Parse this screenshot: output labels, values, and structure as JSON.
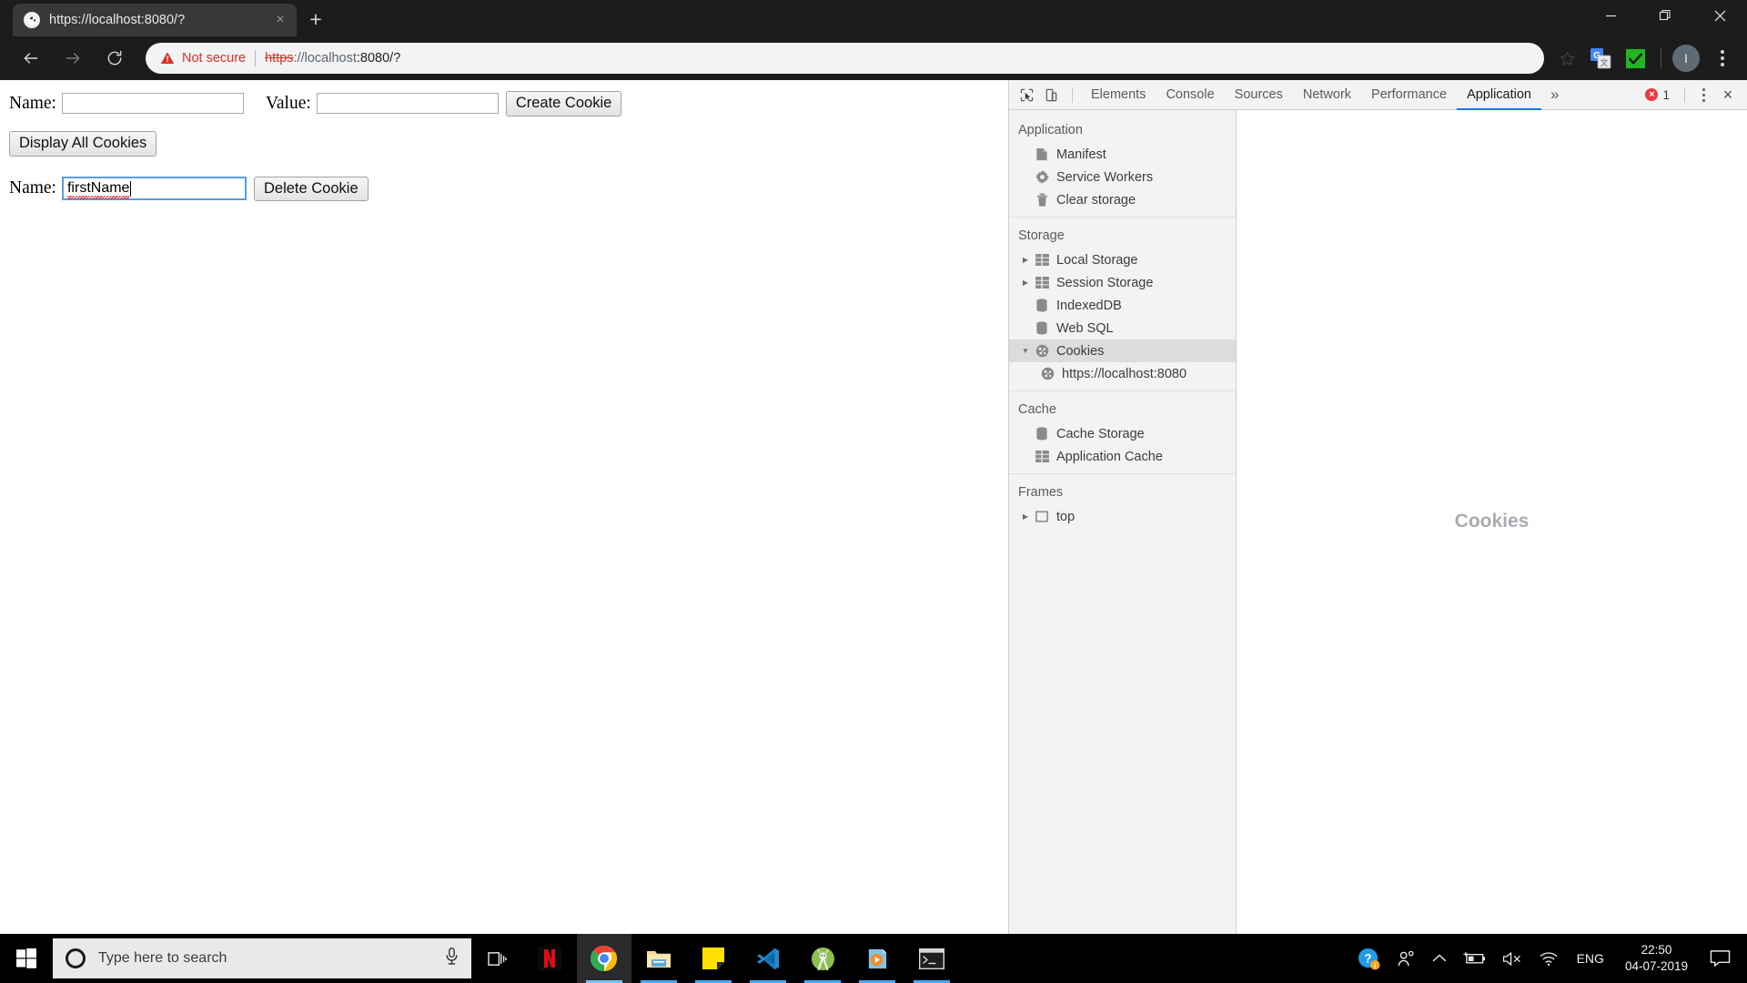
{
  "browser": {
    "tab": {
      "title": "https://localhost:8080/?",
      "favicon": "globe-icon",
      "close": "×"
    },
    "new_tab": "+",
    "window_controls": {
      "minimize": "minimize-icon",
      "maximize": "restore-icon",
      "close": "close-icon"
    },
    "toolbar": {
      "back": "back-arrow-icon",
      "forward": "forward-arrow-icon",
      "reload": "reload-icon",
      "security_label": "Not secure",
      "url_scheme": "https",
      "url_rest": "://localhost",
      "url_tail": ":8080/?",
      "bookmark": "star-icon",
      "extensions": [
        "google-translate-icon",
        "green-check-icon"
      ],
      "profile_initial": "I",
      "menu": "kebab-menu-icon"
    }
  },
  "page": {
    "create_row": {
      "name_label": "Name:",
      "name_value": "",
      "value_label": "Value:",
      "value_value": "",
      "button": "Create Cookie"
    },
    "display_all_button": "Display All Cookies",
    "delete_row": {
      "name_label": "Name:",
      "name_value": "firstName",
      "button": "Delete Cookie"
    }
  },
  "devtools": {
    "toolbar": {
      "inspect_icon": "inspect-element-icon",
      "device_icon": "device-toolbar-icon",
      "tabs": [
        {
          "label": "Elements",
          "active": false
        },
        {
          "label": "Console",
          "active": false
        },
        {
          "label": "Sources",
          "active": false
        },
        {
          "label": "Network",
          "active": false
        },
        {
          "label": "Performance",
          "active": false
        },
        {
          "label": "Application",
          "active": true
        }
      ],
      "overflow": "»",
      "error_count": "1",
      "more_options": "kebab-menu-icon",
      "close": "×"
    },
    "sidebar": {
      "sections": [
        {
          "title": "Application",
          "items": [
            {
              "label": "Manifest",
              "icon": "manifest-document-icon",
              "arrow": null,
              "selected": false,
              "indent": 0
            },
            {
              "label": "Service Workers",
              "icon": "gear-icon",
              "arrow": null,
              "selected": false,
              "indent": 0
            },
            {
              "label": "Clear storage",
              "icon": "trash-icon",
              "arrow": null,
              "selected": false,
              "indent": 0
            }
          ]
        },
        {
          "title": "Storage",
          "items": [
            {
              "label": "Local Storage",
              "icon": "table-icon",
              "arrow": "collapsed",
              "selected": false,
              "indent": 0
            },
            {
              "label": "Session Storage",
              "icon": "table-icon",
              "arrow": "collapsed",
              "selected": false,
              "indent": 0
            },
            {
              "label": "IndexedDB",
              "icon": "database-icon",
              "arrow": null,
              "selected": false,
              "indent": 0
            },
            {
              "label": "Web SQL",
              "icon": "database-icon",
              "arrow": null,
              "selected": false,
              "indent": 0
            },
            {
              "label": "Cookies",
              "icon": "cookie-icon",
              "arrow": "expanded",
              "selected": true,
              "indent": 0
            },
            {
              "label": "https://localhost:8080",
              "icon": "cookie-icon",
              "arrow": null,
              "selected": false,
              "indent": 1
            }
          ]
        },
        {
          "title": "Cache",
          "items": [
            {
              "label": "Cache Storage",
              "icon": "database-icon",
              "arrow": null,
              "selected": false,
              "indent": 0
            },
            {
              "label": "Application Cache",
              "icon": "table-icon",
              "arrow": null,
              "selected": false,
              "indent": 0
            }
          ]
        },
        {
          "title": "Frames",
          "items": [
            {
              "label": "top",
              "icon": "frame-icon",
              "arrow": "collapsed",
              "selected": false,
              "indent": 0
            }
          ]
        }
      ]
    },
    "main_panel": {
      "empty_title": "Cookies"
    }
  },
  "taskbar": {
    "start": "windows-logo-icon",
    "search_placeholder": "Type here to search",
    "cortana": "cortana-circle-icon",
    "mic": "microphone-icon",
    "task_view": "task-view-icon",
    "apps": [
      {
        "name": "netflix",
        "active": false,
        "running": false
      },
      {
        "name": "google-chrome",
        "active": true,
        "running": true
      },
      {
        "name": "file-explorer",
        "active": false,
        "running": true
      },
      {
        "name": "sticky-notes",
        "active": false,
        "running": true
      },
      {
        "name": "visual-studio-code",
        "active": false,
        "running": true
      },
      {
        "name": "android-studio",
        "active": false,
        "running": true
      },
      {
        "name": "media-player",
        "active": false,
        "running": true
      },
      {
        "name": "terminal",
        "active": false,
        "running": true
      }
    ],
    "tray": {
      "help": "help-question-icon",
      "people": "people-icon",
      "show_hidden": "chevron-up-icon",
      "battery": "battery-charging-icon",
      "volume": "volume-muted-icon",
      "network": "wifi-icon",
      "language": "ENG",
      "time": "22:50",
      "date": "04-07-2019",
      "action_center": "notification-icon"
    }
  },
  "colors": {
    "accent_blue": "#1a73e8",
    "error_red": "#eb3941",
    "not_secure_red": "#d93025",
    "devtools_bg": "#f3f3f3",
    "taskbar_bg": "#000000"
  }
}
